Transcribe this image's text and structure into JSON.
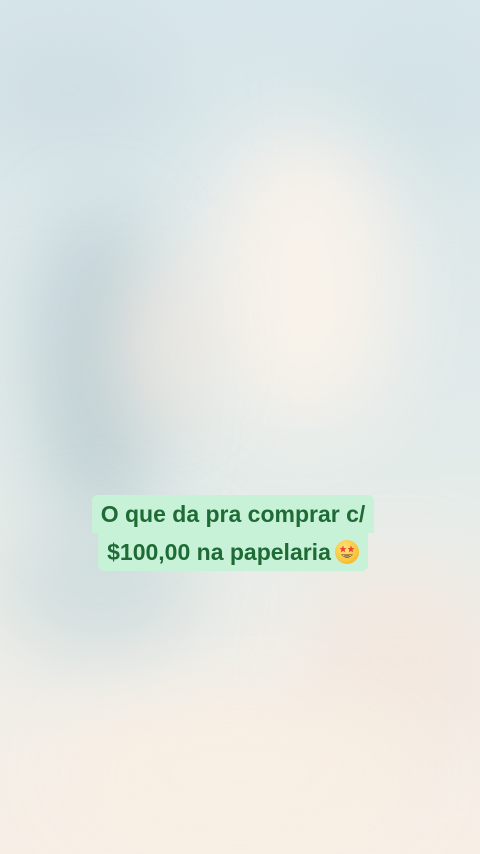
{
  "caption": {
    "line1": "O que da pra comprar c/",
    "line2": "$100,00 na papelaria"
  },
  "emoji": {
    "icon": "star-struck-emoji-icon"
  },
  "colors": {
    "caption_bg": "#c8f2d8",
    "caption_text": "#1f6b36"
  }
}
